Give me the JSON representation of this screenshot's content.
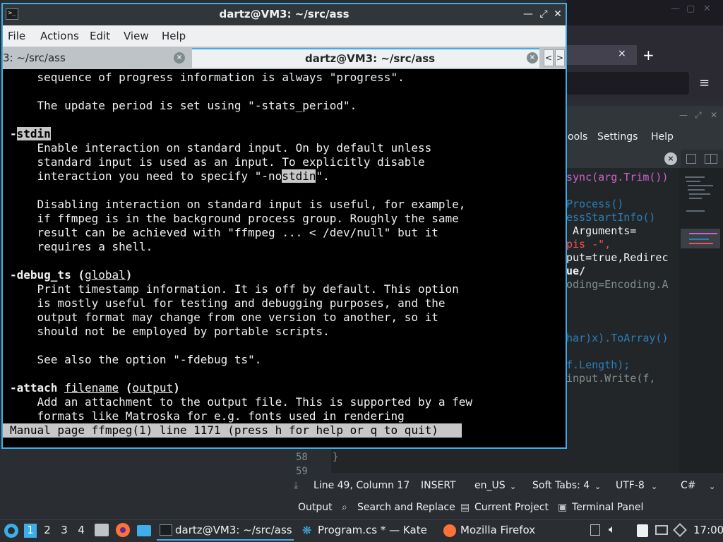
{
  "firefox": {
    "tab_close": "×",
    "new_tab": "+",
    "menu_icon": "≡",
    "min": "—",
    "max": "▢",
    "close": "✕"
  },
  "kate": {
    "menu": [
      "ools",
      "Settings",
      "Help"
    ],
    "tab_close": "×",
    "code": [
      [
        "sync(arg.Trim())"
      ],
      [
        "Process()"
      ],
      [
        "essStartInfo()"
      ],
      [
        " Arguments="
      ],
      [
        "pis -\","
      ],
      [
        "put=true,Redirec"
      ],
      [
        "ue/"
      ],
      [
        "oding=Encoding.A"
      ],
      [
        "har)x).ToArray()"
      ],
      [
        "f.Length);"
      ],
      [
        "input.Write(f,"
      ]
    ],
    "line_numbers": [
      "58",
      "59"
    ],
    "brace": "}",
    "status": {
      "position": "Line 49, Column 17",
      "mode": "INSERT",
      "lang_dict": "en_US",
      "indent": "Soft Tabs: 4",
      "encoding": "UTF-8",
      "syntax": "C#"
    },
    "toolviews": [
      "Output",
      "Search and Replace",
      "Current Project",
      "Terminal Panel"
    ]
  },
  "terminal": {
    "title": "dartz@VM3: ~/src/ass",
    "icon_text": ">_",
    "menu": [
      "File",
      "Actions",
      "Edit",
      "View",
      "Help"
    ],
    "tab1_label": "3: ~/src/ass",
    "tab2_label": "dartz@VM3: ~/src/ass",
    "tab_close": "×",
    "scroll_left": "<",
    "scroll_right": ">",
    "lines": [
      "    sequence of progress information is always \"progress\".",
      "",
      "    The update period is set using \"-stats_period\".",
      "",
      "-",
      "    Enable interaction on standard input. On by default unless",
      "    standard input is used as an input. To explicitly disable",
      "    interaction you need to specify \"-no",
      "",
      "    Disabling interaction on standard input is useful, for example,",
      "    if ffmpeg is in the background process group. Roughly the same",
      "    result can be achieved with \"ffmpeg ... < /dev/null\" but it",
      "    requires a shell.",
      "",
      "-debug_ts (",
      "    Print timestamp information. It is off by default. This option",
      "    is mostly useful for testing and debugging purposes, and the",
      "    output format may change from one version to another, so it",
      "    should not be employed by portable scripts.",
      "",
      "    See also the option \"-fdebug ts\".",
      "",
      "-attach ",
      "    Add an attachment to the output file. This is supported by a few",
      "    formats like Matroska for e.g. fonts used in rendering"
    ],
    "stdin_hl": "stdin",
    "stdin_hl2": "stdin",
    "after_stdin2": "\".",
    "global": "global",
    "close_paren": ")",
    "filename": "filename",
    "space_paren": " (",
    "output": "output",
    "status": "Manual page ffmpeg(1) line 1171 (press h for help or q to quit)"
  },
  "taskbar": {
    "desktops": [
      "1",
      "2",
      "3",
      "4"
    ],
    "tasks": [
      "dartz@VM3: ~/src/ass",
      "Program.cs * — Kate",
      "Mozilla Firefox"
    ],
    "clock": "17:00"
  },
  "colors": {
    "accent": "#3daee9",
    "keyword": "#c864c8",
    "type": "#2980b9",
    "string": "#f44f4f"
  }
}
